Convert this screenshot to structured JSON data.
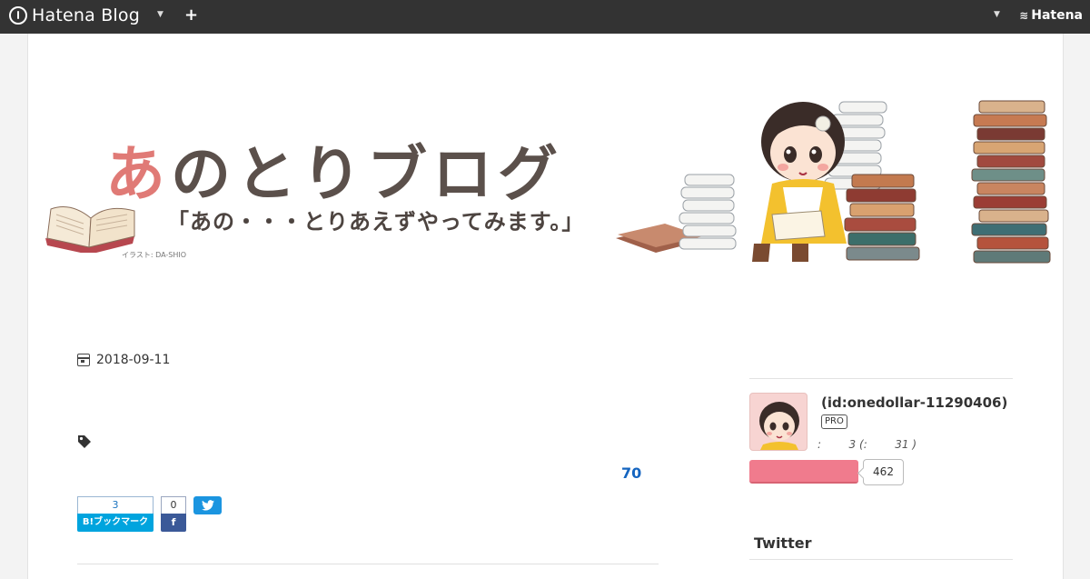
{
  "navbar": {
    "logo_text": "Hatena Blog",
    "plus_label": "+",
    "brand_right": "Hatena",
    "colors": {
      "bar": "#333333"
    }
  },
  "banner": {
    "title_first": "あ",
    "title_rest": "のとりブログ",
    "subtitle": "「あの・・・とりあえずやってみます。」",
    "credit": "イラスト: DA-SHIO"
  },
  "post": {
    "date": "2018-09-11",
    "star_count": "70",
    "share": {
      "hatena_count": "3",
      "hatena_label": "B!ブックマーク",
      "facebook_count": "0"
    }
  },
  "sidebar": {
    "profile_id": "(id:onedollar-11290406)",
    "pro_badge": "PRO",
    "reader_line": ":        3 (:        31 )",
    "follow_count": "462",
    "section_title": "Twitter",
    "colors": {
      "follow": "#f07b8d"
    }
  }
}
